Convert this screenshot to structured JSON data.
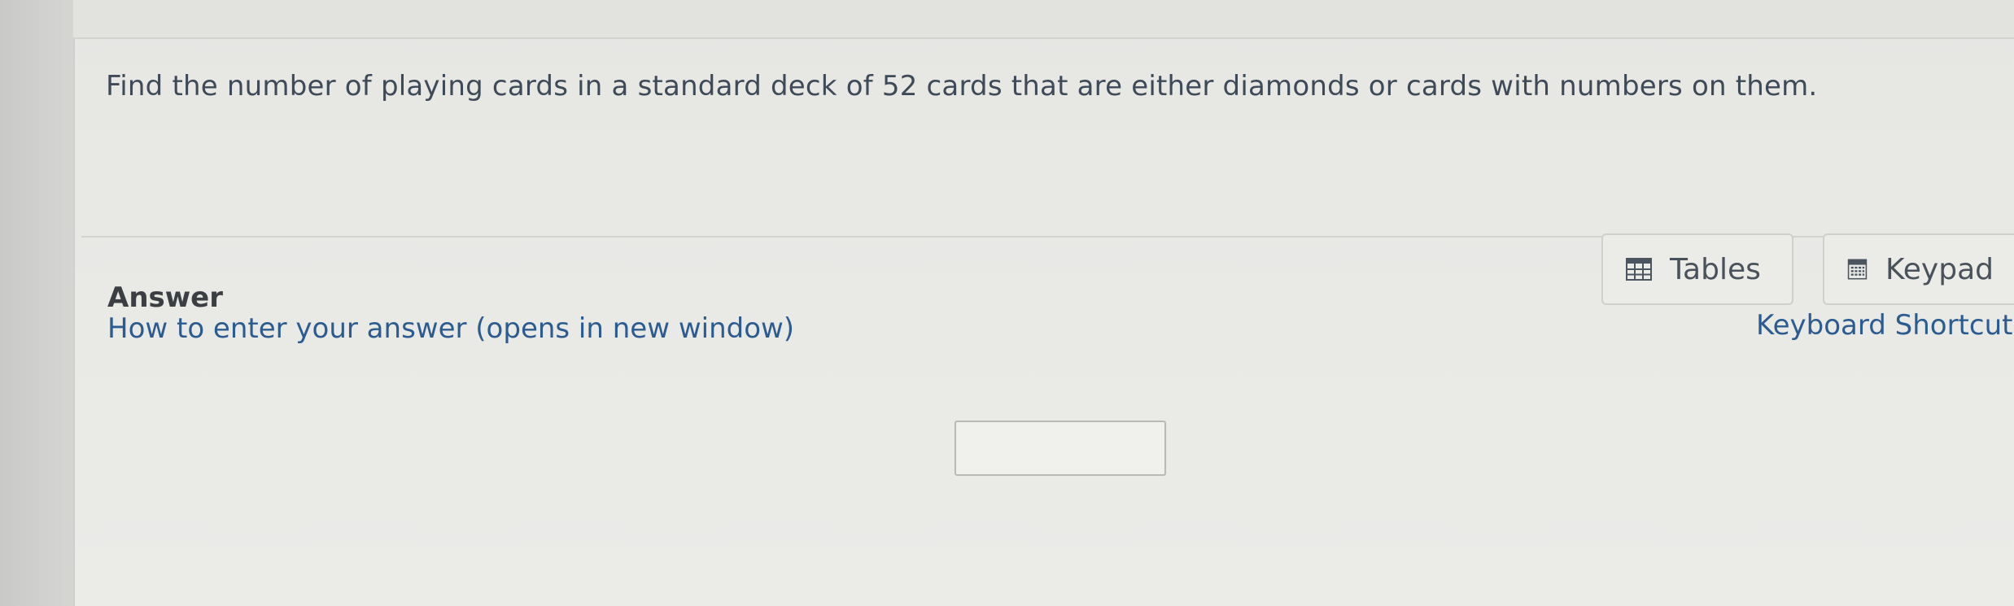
{
  "question": {
    "text": "Find the number of playing cards in a standard deck of 52 cards that are either diamonds or cards with numbers on them."
  },
  "answer": {
    "label": "Answer",
    "help_link": "How to enter your answer (opens in new window)",
    "input_value": ""
  },
  "tools": {
    "tables_label": "Tables",
    "keypad_label": "Keypad",
    "shortcut_label": "Keyboard Shortcut",
    "tables_icon": "table-grid-icon",
    "keypad_icon": "calculator-keypad-icon"
  },
  "colors": {
    "text": "#3e4a57",
    "link": "#2c5b8f",
    "border": "#cfd0cd"
  }
}
